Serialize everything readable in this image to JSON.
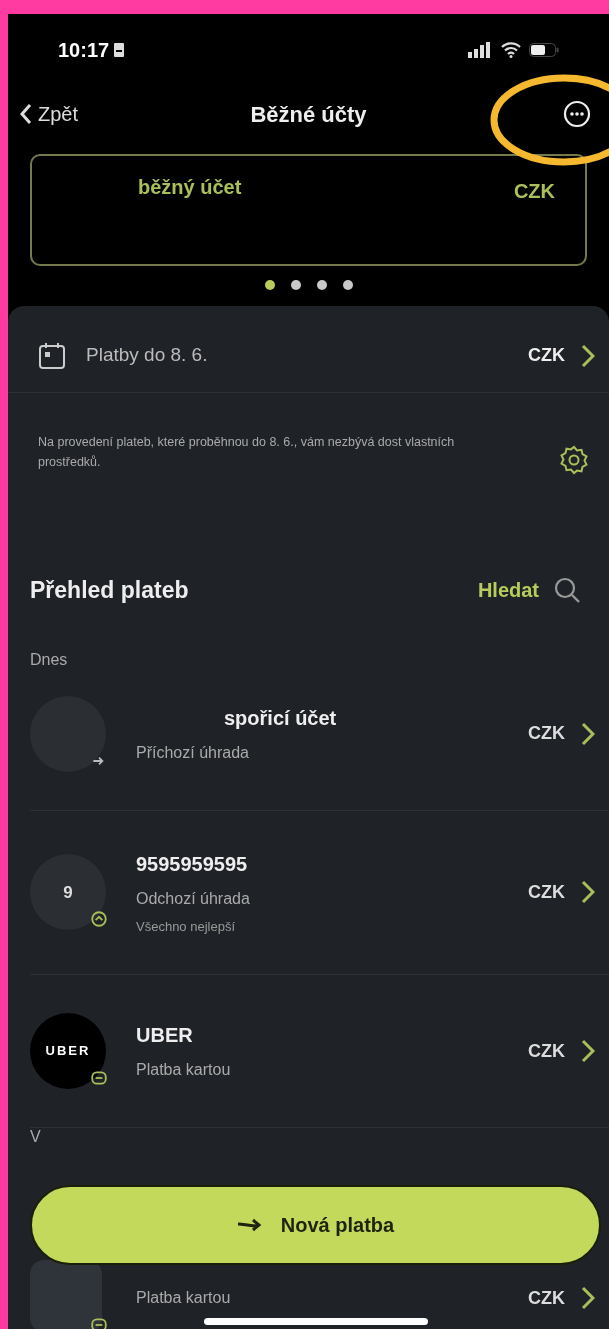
{
  "status_bar": {
    "time": "10:17"
  },
  "nav": {
    "back": "Zpět",
    "title": "Běžné účty",
    "more_highlighted": true
  },
  "account_card": {
    "name": "běžný účet",
    "currency": "CZK"
  },
  "pager": [
    {
      "selected": true
    },
    {
      "selected": false
    },
    {
      "selected": false
    },
    {
      "selected": false
    }
  ],
  "upcoming": {
    "label": "Platby do 8. 6.",
    "currency": "CZK",
    "notice": "Na provedení plateb, které proběhnou do 8. 6., vám nezbývá dost vlastních prostředků."
  },
  "payments": {
    "title": "Přehled plateb",
    "search": "Hledat",
    "sections": [
      {
        "label": "Dnes",
        "rows": [
          {
            "avatar": {
              "kind": "blank"
            },
            "badge": {
              "kind": "incoming"
            },
            "name": "spořicí účet",
            "type": "Příchozí úhrada",
            "currency": "CZK"
          },
          {
            "avatar": {
              "kind": "initial",
              "text": "9"
            },
            "badge": {
              "kind": "outgoing"
            },
            "name": "9595959595",
            "type": "Odchozí úhrada",
            "note": "Všechno nejlepší",
            "currency": "CZK"
          },
          {
            "avatar": {
              "kind": "logo",
              "text": "UBER"
            },
            "badge": {
              "kind": "card"
            },
            "name": "UBER",
            "type": "Platba kartou",
            "currency": "CZK"
          }
        ]
      },
      {
        "label": "V",
        "rows": [
          {
            "avatar": {
              "kind": "tile"
            },
            "badge": {
              "kind": "card"
            },
            "type": "Platba kartou",
            "currency": "CZK"
          }
        ]
      }
    ]
  },
  "new_payment_button": "Nová platba"
}
